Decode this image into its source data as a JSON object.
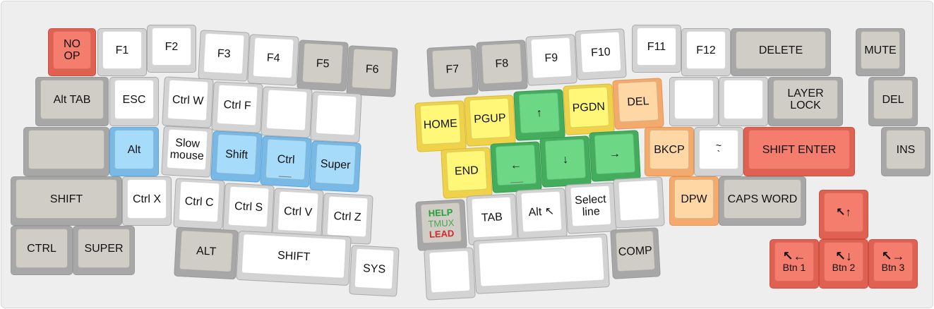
{
  "keys": {
    "noop": "NO\nOP",
    "f1": "F1",
    "f2": "F2",
    "f3": "F3",
    "f4": "F4",
    "f5": "F5",
    "f6": "F6",
    "alttab": "Alt TAB",
    "esc": "ESC",
    "ctrlw": "Ctrl W",
    "ctrlf": "Ctrl F",
    "alt_l": "Alt",
    "slowmouse": "Slow\nmouse",
    "shift_mod": "Shift",
    "ctrl_mod": "Ctrl",
    "super_mod": "Super",
    "shift_l": "SHIFT",
    "ctrlx": "Ctrl X",
    "ctrlc": "Ctrl C",
    "ctrls": "Ctrl S",
    "ctrlv": "Ctrl V",
    "ctrlz": "Ctrl Z",
    "ctrl_l": "CTRL",
    "super_l": "SUPER",
    "alt_thumb": "ALT",
    "shift_thumb": "SHIFT",
    "sys": "SYS",
    "f7": "F7",
    "f8": "F8",
    "f9": "F9",
    "f10": "F10",
    "f11": "F11",
    "f12": "F12",
    "delete": "DELETE",
    "mute": "MUTE",
    "home": "HOME",
    "pgup": "PGUP",
    "up": "↑",
    "pgdn": "PGDN",
    "del_r": "DEL",
    "layerlock": "LAYER\nLOCK",
    "del_far": "DEL",
    "end": "END",
    "left": "←",
    "down": "↓",
    "right": "→",
    "bkcp": "BKCP",
    "tilde": "~\n`",
    "shiftenter": "SHIFT ENTER",
    "ins": "INS",
    "help": "HELP",
    "tmux": "TMUX",
    "lead": "LEAD",
    "tab": "TAB",
    "altcursor": "Alt ↖",
    "selectline": "Select\nline",
    "dpw": "DPW",
    "capsword": "CAPS WORD",
    "comp": "COMP",
    "btn_up": "↖↑",
    "btn1_icon": "↖←",
    "btn1": "Btn 1",
    "btn2_icon": "↖↓",
    "btn2": "Btn 2",
    "btn3_icon": "↖→",
    "btn3": "Btn 3"
  },
  "colors": {
    "red": "#f47d6d",
    "blue": "#a6dcfa",
    "yellow": "#fff777",
    "green": "#6cd785",
    "orange": "#ffd7a5",
    "gray": "#d4d2cc",
    "white": "#ffffff"
  }
}
